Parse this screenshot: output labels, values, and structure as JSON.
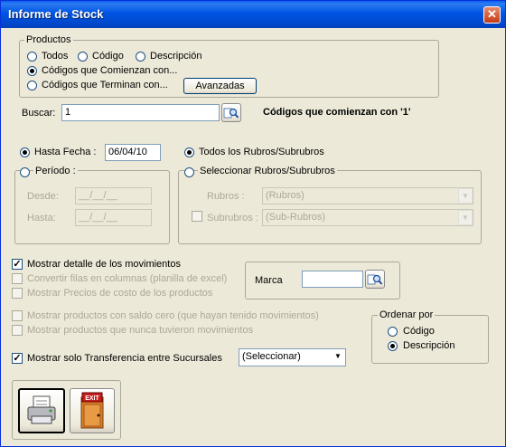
{
  "window": {
    "title": "Informe de Stock",
    "close_label": "✕"
  },
  "productos": {
    "legend": "Productos",
    "options": [
      "Todos",
      "Código",
      "Descripción",
      "Códigos que Comienzan con...",
      "Códigos que Terminan con..."
    ],
    "selected": "Códigos que Comienzan con...",
    "advanced_label": "Avanzadas"
  },
  "buscar": {
    "label": "Buscar:",
    "value": "1",
    "result_text": "Códigos que comienzan con '1'"
  },
  "fecha": {
    "hasta_label": "Hasta Fecha :",
    "hasta_value": "06/04/10",
    "periodo_label": "Período :",
    "desde_label": "Desde:",
    "desde_value": "__/__/__",
    "hasta2_label": "Hasta:",
    "hasta2_value": "__/__/__",
    "selected": "Hasta Fecha"
  },
  "rubros": {
    "todos_label": "Todos los Rubros/Subrubros",
    "seleccionar_label": "Seleccionar Rubros/Subrubros",
    "rubros_label": "Rubros :",
    "rubros_value": "(Rubros)",
    "subrubros_label": "Subrubros :",
    "subrubros_value": "(Sub-Rubros)",
    "selected": "Todos los Rubros/Subrubros"
  },
  "options": {
    "mostrar_detalle": {
      "label": "Mostrar detalle de los movimientos",
      "checked": true
    },
    "convertir": {
      "label": "Convertir filas en columnas (planilla de excel)",
      "checked": false
    },
    "precios": {
      "label": "Mostrar Precios de costo de los productos",
      "checked": false
    },
    "saldo_cero": {
      "label": "Mostrar productos con saldo cero (que hayan tenido movimientos)",
      "checked": false
    },
    "nunca": {
      "label": "Mostrar productos que nunca tuvieron movimientos",
      "checked": false
    },
    "transferencia": {
      "label": "Mostrar solo Transferencia entre Sucursales",
      "checked": true
    },
    "transferencia_select": "(Seleccionar)"
  },
  "marca": {
    "label": "Marca",
    "value": ""
  },
  "ordenar": {
    "legend": "Ordenar por",
    "options": [
      "Código",
      "Descripción"
    ],
    "selected": "Descripción"
  },
  "actions": {
    "print_icon": "printer-icon",
    "exit_icon": "exit-door-icon",
    "exit_text": "EXIT"
  },
  "colors": {
    "title_bar": "#0054e3",
    "window_bg": "#ece9d8",
    "radio_dot": "#21a121"
  }
}
